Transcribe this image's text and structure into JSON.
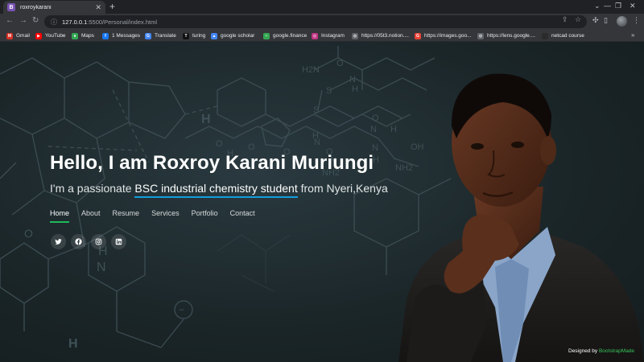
{
  "browser": {
    "tab_title": "roxroykarani",
    "tab_favicon_letter": "B",
    "url_host": "127.0.0.1",
    "url_rest": ":5500/Personal/index.html",
    "bookmarks": [
      {
        "label": "Gmail",
        "icon": "gmail-icon",
        "color": "#d93025",
        "glyph": "M"
      },
      {
        "label": "YouTube",
        "icon": "youtube-icon",
        "color": "#ff0000",
        "glyph": "▶"
      },
      {
        "label": "Maps",
        "icon": "maps-icon",
        "color": "#34a853",
        "glyph": "●"
      },
      {
        "label": "1 Messages",
        "icon": "facebook-icon",
        "color": "#1877f2",
        "glyph": "f"
      },
      {
        "label": "Translate",
        "icon": "translate-icon",
        "color": "#4285f4",
        "glyph": "G"
      },
      {
        "label": "turing",
        "icon": "turing-icon",
        "color": "#111111",
        "glyph": "T"
      },
      {
        "label": "google scholar",
        "icon": "scholar-icon",
        "color": "#4285f4",
        "glyph": "▲"
      },
      {
        "label": "google.finance",
        "icon": "finance-icon",
        "color": "#34a853",
        "glyph": "~"
      },
      {
        "label": "Instagram",
        "icon": "instagram-icon",
        "color": "#c13584",
        "glyph": "◎"
      },
      {
        "label": "https://05t3.notion....",
        "icon": "globe-icon",
        "color": "#5f6368",
        "glyph": "◍"
      },
      {
        "label": "https://images.goo...",
        "icon": "google-icon",
        "color": "#ea4335",
        "glyph": "G"
      },
      {
        "label": "https://lens.google....",
        "icon": "globe-icon",
        "color": "#5f6368",
        "glyph": "◍"
      },
      {
        "label": "netcad course",
        "icon": "folder-icon",
        "color": "#2b2b2b",
        "glyph": ""
      }
    ],
    "more_bookmarks": "»"
  },
  "hero": {
    "title": "Hello, I am Roxroy Karani Muriungi",
    "subtitle_prefix": "I'm a passionate ",
    "subtitle_typed": "BSC industrial chemistry student",
    "subtitle_suffix": " from Nyeri,Kenya"
  },
  "nav": {
    "items": [
      "Home",
      "About",
      "Resume",
      "Services",
      "Portfolio",
      "Contact"
    ],
    "active": "Home"
  },
  "social": [
    "twitter-icon",
    "facebook-icon",
    "instagram-icon",
    "linkedin-icon"
  ],
  "footer": {
    "credit_prefix": "Designed by ",
    "credit_link": "BootstrapMade"
  },
  "molecule_labels": [
    "H2N",
    "O",
    "N",
    "H",
    "S",
    "S",
    "NH2",
    "O",
    "N",
    "H",
    "O",
    "N",
    "H",
    "NH2",
    "H",
    "N",
    "O",
    "OH",
    "O",
    "H",
    "O",
    "N",
    "H",
    "N",
    "H",
    "O",
    "H"
  ],
  "colors": {
    "accent_green": "#20b85a",
    "typed_underline": "#149ddd",
    "credit_link": "#39c35a"
  }
}
